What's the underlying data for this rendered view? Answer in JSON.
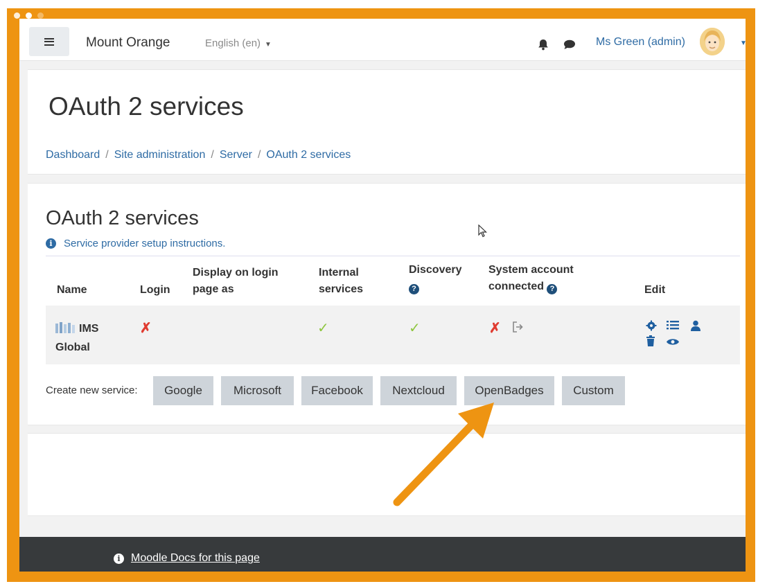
{
  "navbar": {
    "site_name": "Mount Orange",
    "language": "English (en)",
    "user_name": "Ms Green (admin)",
    "icons": [
      "menu-icon",
      "bell-icon",
      "chat-icon",
      "avatar"
    ]
  },
  "header": {
    "title": "OAuth 2 services",
    "breadcrumb": [
      "Dashboard",
      "Site administration",
      "Server",
      "OAuth 2 services"
    ]
  },
  "main": {
    "section_title": "OAuth 2 services",
    "setup_link": "Service provider setup instructions.",
    "table": {
      "columns": [
        "Name",
        "Login",
        "Display on login page as",
        "Internal services",
        "Discovery",
        "System account connected",
        "Edit"
      ],
      "header_lines": {
        "display": [
          "Display on login",
          "page as"
        ],
        "internal": [
          "Internal",
          "services"
        ],
        "system": [
          "System account",
          "connected"
        ]
      },
      "rows": [
        {
          "name_line1": "IMS",
          "name_line2": "Global",
          "login": "✗",
          "display": "",
          "internal": "✓",
          "discovery": "✓",
          "system_account": "✗"
        }
      ]
    },
    "create_label": "Create new service:",
    "service_buttons": [
      "Google",
      "Microsoft",
      "Facebook",
      "Nextcloud",
      "OpenBadges",
      "Custom"
    ]
  },
  "footer": {
    "docs_link": "Moodle Docs for this page"
  },
  "colors": {
    "frame": "#ee9412",
    "link": "#2e6ba4",
    "cross": "#e03c31",
    "check": "#8ec63f",
    "footer": "#373a3c",
    "button": "#ced4da"
  }
}
